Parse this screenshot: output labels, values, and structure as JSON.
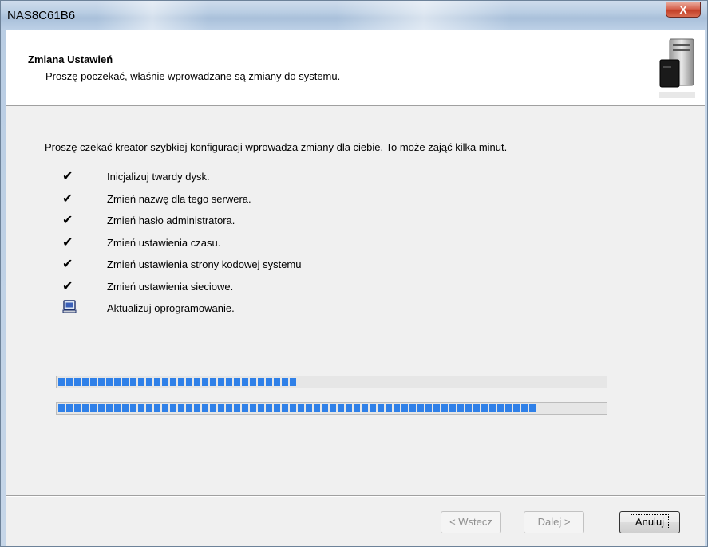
{
  "window": {
    "title": "NAS8C61B6",
    "close_label": "X"
  },
  "header": {
    "title": "Zmiana Ustawień",
    "subtitle": "Proszę poczekać, właśnie wprowadzane są zmiany do systemu.",
    "icon": "nas-server-icon"
  },
  "body": {
    "intro": "Proszę czekać kreator szybkiej konfiguracji wprowadza zmiany dla ciebie. To może zająć kilka minut.",
    "steps": [
      {
        "label": "Inicjalizuj twardy dysk.",
        "status": "done",
        "icon": "checkmark-icon"
      },
      {
        "label": "Zmień nazwę dla tego serwera.",
        "status": "done",
        "icon": "checkmark-icon"
      },
      {
        "label": "Zmień hasło administratora.",
        "status": "done",
        "icon": "checkmark-icon"
      },
      {
        "label": "Zmień ustawienia czasu.",
        "status": "done",
        "icon": "checkmark-icon"
      },
      {
        "label": "Zmień ustawienia strony kodowej systemu",
        "status": "done",
        "icon": "checkmark-icon"
      },
      {
        "label": "Zmień ustawienia sieciowe.",
        "status": "done",
        "icon": "checkmark-icon"
      },
      {
        "label": "Aktualizuj oprogramowanie.",
        "status": "in-progress",
        "icon": "computer-update-icon"
      }
    ],
    "progress": {
      "current_step": 0.44,
      "overall": 0.88
    }
  },
  "buttons": {
    "back": "< Wstecz",
    "next": "Dalej >",
    "cancel": "Anuluj"
  },
  "colors": {
    "progress": "#2f80e8",
    "close": "#c84a33"
  }
}
